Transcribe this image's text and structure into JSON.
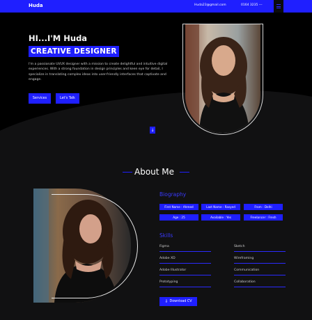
{
  "header": {
    "brand": "Huda",
    "email": "Huda23@gmail.com",
    "phone": "0164 3235 ---"
  },
  "hero": {
    "greeting": "HI...I'M Huda",
    "role": "CREATIVE DESIGNER",
    "intro": "I'm a passionate UI/UX designer with a mission to create delightful and intuitive digital experiences. With a strong foundation in design principles and keen eye for detail, I specialize in translating complex ideas into user-friendly interfaces that captivate and engage.",
    "services_label": "Services",
    "talk_label": "Let's Talk",
    "scroll_icon": "↓"
  },
  "about": {
    "title": "About Me",
    "biography_heading": "Biography",
    "biography": [
      "First Name : Ahmed",
      "Last Name : Rasyed",
      "From : Delhi",
      "Age : 25",
      "Available : Yes",
      "Freelancer : Fresh"
    ],
    "skills_heading": "Skills",
    "skills": [
      "Figma",
      "Sketch",
      "Adobe XD",
      "Wireframing",
      "Adobe Illustrator",
      "Communication",
      "Prototyping",
      "Collaboration"
    ],
    "download_label": "Download CV",
    "download_icon": "⇩"
  },
  "colors": {
    "accent": "#1f1fff",
    "background": "#111112",
    "hero_background": "#000000"
  }
}
